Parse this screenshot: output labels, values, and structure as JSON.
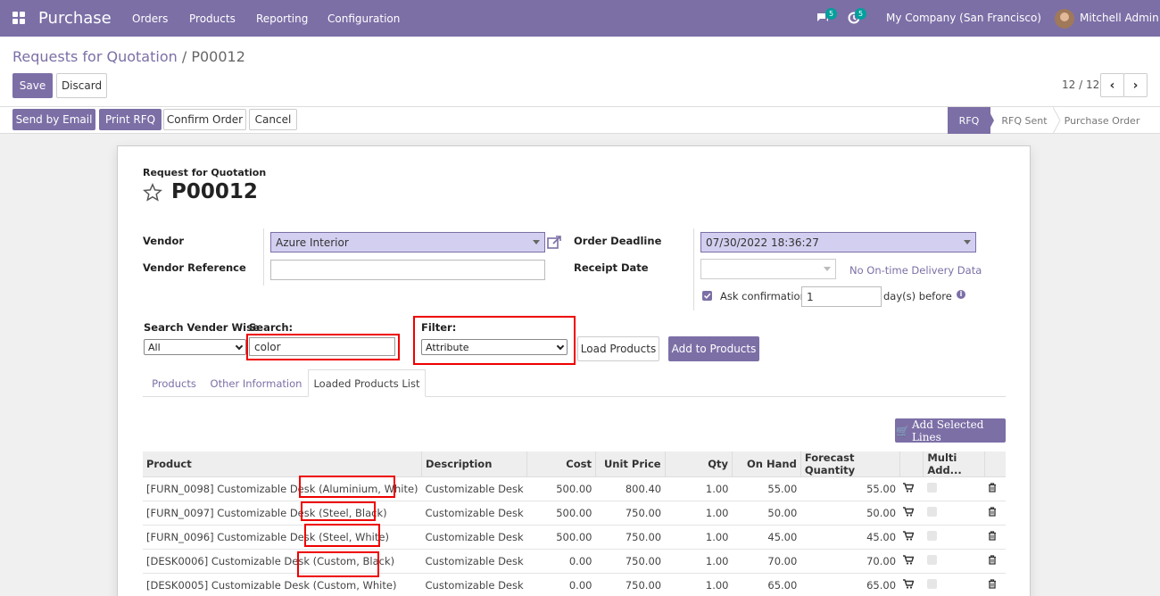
{
  "topbar": {
    "app_name": "Purchase",
    "menus": [
      "Orders",
      "Products",
      "Reporting",
      "Configuration"
    ],
    "messages_count": "5",
    "activities_count": "5",
    "company": "My Company (San Francisco)",
    "user": "Mitchell Admin"
  },
  "breadcrumb": {
    "parent": "Requests for Quotation",
    "separator": "/",
    "current": "P00012"
  },
  "control": {
    "save": "Save",
    "discard": "Discard",
    "pager": "12 / 12"
  },
  "actions": {
    "send_email": "Send by Email",
    "print_rfq": "Print RFQ",
    "confirm_order": "Confirm Order",
    "cancel": "Cancel"
  },
  "statusbar": [
    "RFQ",
    "RFQ Sent",
    "Purchase Order"
  ],
  "form": {
    "subtitle": "Request for Quotation",
    "name": "P00012",
    "vendor_label": "Vendor",
    "vendor_value": "Azure Interior",
    "vendor_ref_label": "Vendor Reference",
    "vendor_ref_value": "",
    "deadline_label": "Order Deadline",
    "deadline_value": "07/30/2022 18:36:27",
    "receipt_label": "Receipt Date",
    "receipt_value": "",
    "ontime_text": "No On-time Delivery Data",
    "ask_confirm_label": "Ask confirmation",
    "ask_confirm_value": "1",
    "days_before": "day(s) before",
    "search_vendor_label": "Search Vender Wise",
    "search_vendor_value": "All",
    "search_label": "Search:",
    "search_value": "color",
    "filter_label": "Filter:",
    "filter_value": "Attribute",
    "load_products": "Load Products",
    "add_to_products": "Add to Products",
    "add_selected_lines": "Add Selected Lines"
  },
  "tabs": [
    "Products",
    "Other Information",
    "Loaded Products List"
  ],
  "table": {
    "headers": [
      "Product",
      "Description",
      "Cost",
      "Unit Price",
      "Qty",
      "On Hand",
      "Forecast Quantity",
      "",
      "Multi Add...",
      ""
    ],
    "rows": [
      {
        "product": "[FURN_0098] Customizable Desk (Aluminium, White)",
        "description": "Customizable Desk",
        "cost": "500.00",
        "unit_price": "800.40",
        "qty": "1.00",
        "on_hand": "55.00",
        "forecast": "55.00"
      },
      {
        "product": "[FURN_0097] Customizable Desk (Steel, Black)",
        "description": "Customizable Desk",
        "cost": "500.00",
        "unit_price": "750.00",
        "qty": "1.00",
        "on_hand": "50.00",
        "forecast": "50.00"
      },
      {
        "product": "[FURN_0096] Customizable Desk (Steel, White)",
        "description": "Customizable Desk",
        "cost": "500.00",
        "unit_price": "750.00",
        "qty": "1.00",
        "on_hand": "45.00",
        "forecast": "45.00"
      },
      {
        "product": "[DESK0006] Customizable Desk (Custom, Black)",
        "description": "Customizable Desk",
        "cost": "0.00",
        "unit_price": "750.00",
        "qty": "1.00",
        "on_hand": "70.00",
        "forecast": "70.00"
      },
      {
        "product": "[DESK0005] Customizable Desk (Custom, White)",
        "description": "Customizable Desk",
        "cost": "0.00",
        "unit_price": "750.00",
        "qty": "1.00",
        "on_hand": "65.00",
        "forecast": "65.00"
      }
    ]
  },
  "colors": {
    "brand": "#7c6fa6",
    "badge": "#00a09d",
    "highlight": "#e00000"
  }
}
